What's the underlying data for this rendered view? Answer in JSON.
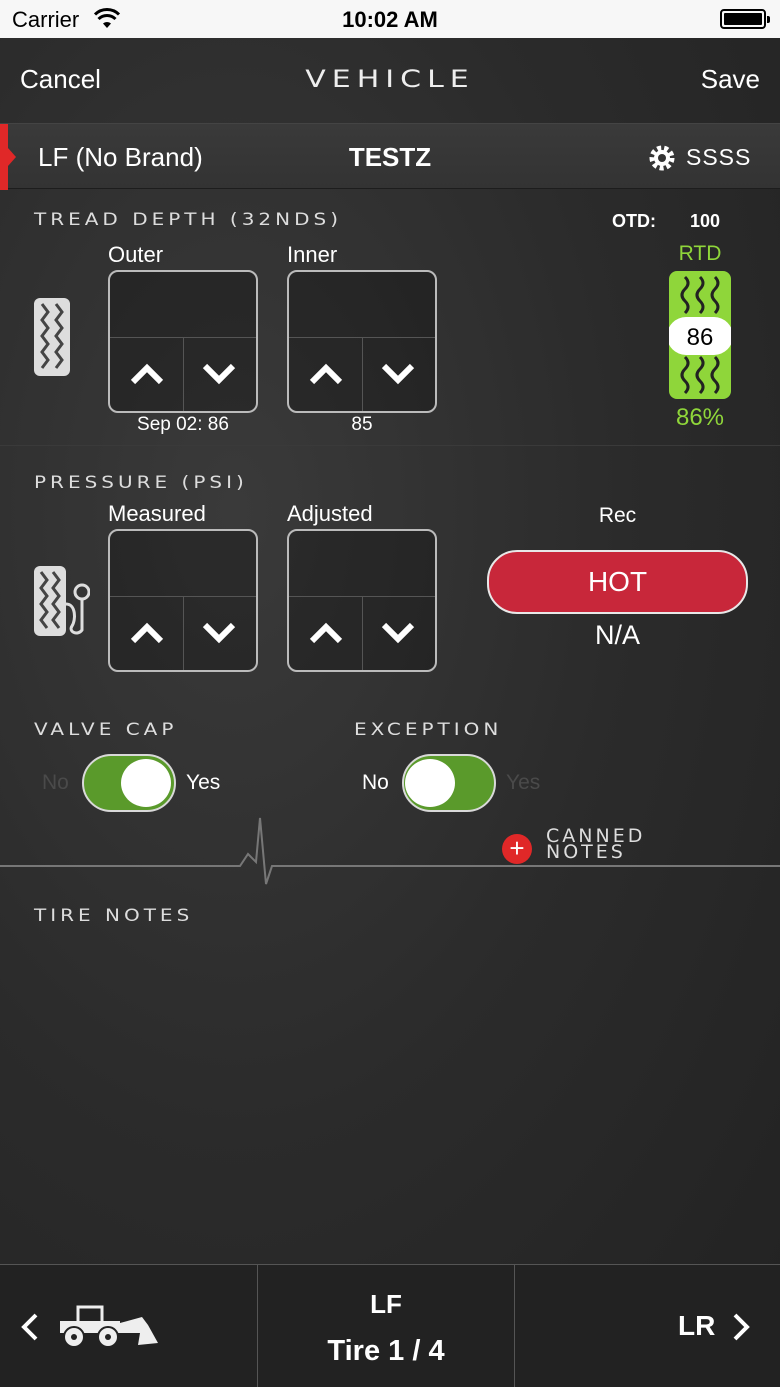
{
  "status_bar": {
    "carrier": "Carrier",
    "time": "10:02 AM"
  },
  "nav": {
    "cancel_label": "Cancel",
    "title": "VEHICLE",
    "save_label": "Save"
  },
  "tire_header": {
    "position": "LF (No Brand)",
    "vehicle_id": "TESTZ",
    "serial": "SSSS"
  },
  "tread": {
    "title": "TREAD DEPTH   (32NDS)",
    "otd_label": "OTD:",
    "otd_value": "100",
    "outer_label": "Outer",
    "inner_label": "Inner",
    "outer_value": "",
    "inner_value": "",
    "outer_previous": "Sep 02: 86",
    "inner_previous": "85",
    "rtd_label": "RTD",
    "rtd_value": "86",
    "rtd_percent": "86%",
    "rtd_level": 0.86,
    "accent_color": "#8fd63a"
  },
  "pressure": {
    "title": "PRESSURE   (PSI)",
    "measured_label": "Measured",
    "adjusted_label": "Adjusted",
    "measured_value": "",
    "adjusted_value": "",
    "rec_label": "Rec",
    "hot_label": "HOT",
    "rec_value": "N/A",
    "hot_color": "#c8273a"
  },
  "valve_cap": {
    "title": "VALVE CAP",
    "no_label": "No",
    "yes_label": "Yes",
    "state": "Yes"
  },
  "exception": {
    "title": "EXCEPTION",
    "no_label": "No",
    "yes_label": "Yes",
    "state": "No"
  },
  "canned_notes": {
    "label_line1": "CANNED",
    "label_line2": "NOTES"
  },
  "tire_notes": {
    "title": "TIRE NOTES",
    "value": ""
  },
  "bottom_nav": {
    "current_position": "LF",
    "tire_count": "Tire 1 / 4",
    "next_position": "LR"
  },
  "icons": {
    "wifi": "wifi-icon",
    "battery": "battery-icon",
    "gear": "gear-icon",
    "tread": "tire-tread-icon",
    "pressure": "tire-pressure-icon",
    "arrow_up": "chevron-up-icon",
    "arrow_down": "chevron-down-icon",
    "prev": "chevron-left-icon",
    "next": "chevron-right-icon",
    "loader": "wheel-loader-icon"
  }
}
